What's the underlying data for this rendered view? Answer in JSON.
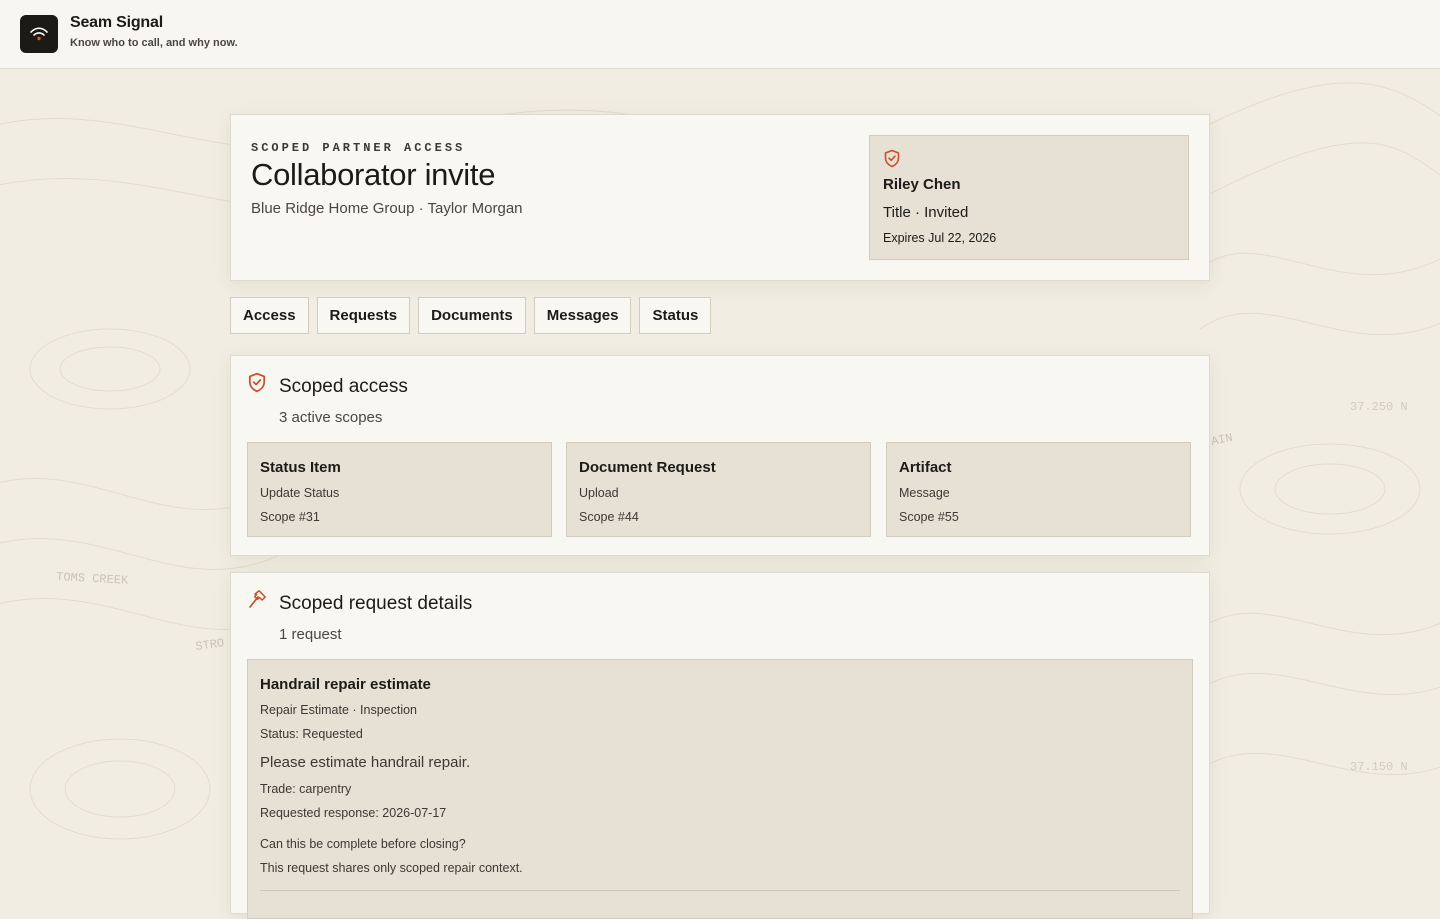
{
  "app": {
    "name": "Seam Signal",
    "tagline": "Know who to call, and why now."
  },
  "header": {
    "eyebrow": "SCOPED PARTNER ACCESS",
    "title": "Collaborator invite",
    "subtitle": "Blue Ridge Home Group · Taylor Morgan",
    "invite": {
      "name": "Riley Chen",
      "role_status": "Title · Invited",
      "expires": "Expires Jul 22, 2026"
    }
  },
  "tabs": [
    {
      "label": "Access"
    },
    {
      "label": "Requests"
    },
    {
      "label": "Documents"
    },
    {
      "label": "Messages"
    },
    {
      "label": "Status"
    }
  ],
  "scoped_access": {
    "title": "Scoped access",
    "count": "3 active scopes",
    "items": [
      {
        "title": "Status Item",
        "action": "Update Status",
        "scope": "Scope #31"
      },
      {
        "title": "Document Request",
        "action": "Upload",
        "scope": "Scope #44"
      },
      {
        "title": "Artifact",
        "action": "Message",
        "scope": "Scope #55"
      }
    ]
  },
  "request_details": {
    "title": "Scoped request details",
    "count": "1 request",
    "request": {
      "title": "Handrail repair estimate",
      "type": "Repair Estimate · Inspection",
      "status": "Status: Requested",
      "body": "Please estimate handrail repair.",
      "trade": "Trade: carpentry",
      "requested_response": "Requested response: 2026-07-17",
      "question": "Can this be complete before closing?",
      "note": "This request shares only scoped repair context."
    }
  },
  "map_labels": {
    "lat_1": "37.250 N",
    "lat_2": "37.150 N",
    "creek": "TOMS CREEK",
    "stro": "STRO",
    "ain": "AIN"
  },
  "colors": {
    "accent": "#c8502a",
    "background": "#f1ede2",
    "panel": "#e6e0d5",
    "card": "#f9f7f2"
  }
}
